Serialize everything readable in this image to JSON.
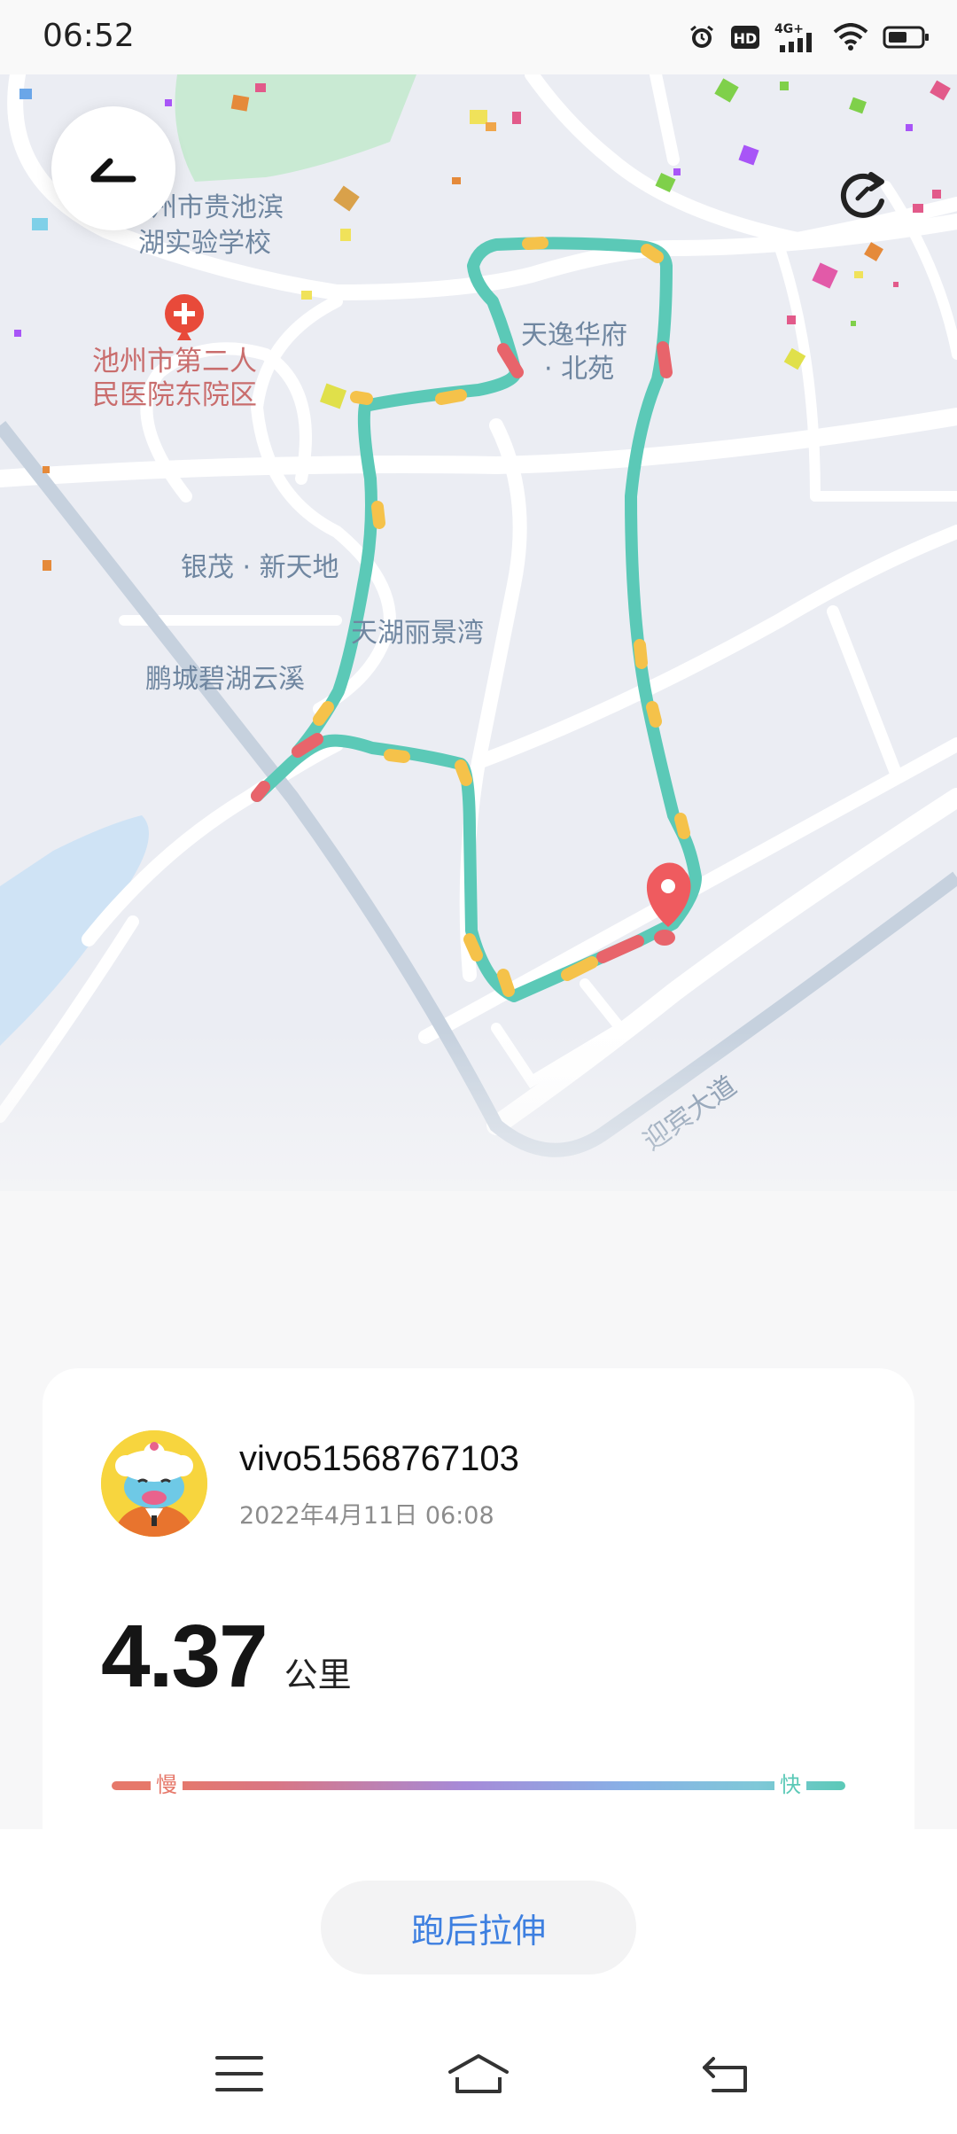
{
  "status_bar": {
    "time": "06:52",
    "icons": [
      "alarm-icon",
      "hd-icon",
      "4g-signal-icon",
      "wifi-icon",
      "battery-icon"
    ],
    "network_label": "4G+",
    "hd_label": "HD"
  },
  "map": {
    "labels": {
      "school": "池州市贵池滨\n湖实验学校",
      "school_line1": "州市贵池滨",
      "school_line2": "湖实验学校",
      "hospital_line1": "池州市第二人",
      "hospital_line2": "民医院东院区",
      "tianyi_line1": "天逸华府",
      "tianyi_line2": "· 北苑",
      "yinmao": "银茂 · 新天地",
      "tianhu": "天湖丽景湾",
      "pengcheng": "鹏城碧湖云溪",
      "yingbin": "迎宾大道"
    },
    "colors": {
      "route": "#5bc9b7",
      "slow": "#e8646b",
      "medium": "#f5c24a",
      "pin": "#ef5b5f"
    }
  },
  "controls": {
    "back_icon": "back-arrow-icon",
    "replay_icon": "replay-icon"
  },
  "record": {
    "username": "vivo51568767103",
    "datetime": "2022年4月11日  06:08",
    "distance": "4.37",
    "unit": "公里",
    "pace_slow_label": "慢",
    "pace_fast_label": "快"
  },
  "actions": {
    "stretch_label": "跑后拉伸"
  },
  "nav": {
    "menu_icon": "menu-icon",
    "home_icon": "home-icon",
    "back_icon": "back-nav-icon"
  }
}
